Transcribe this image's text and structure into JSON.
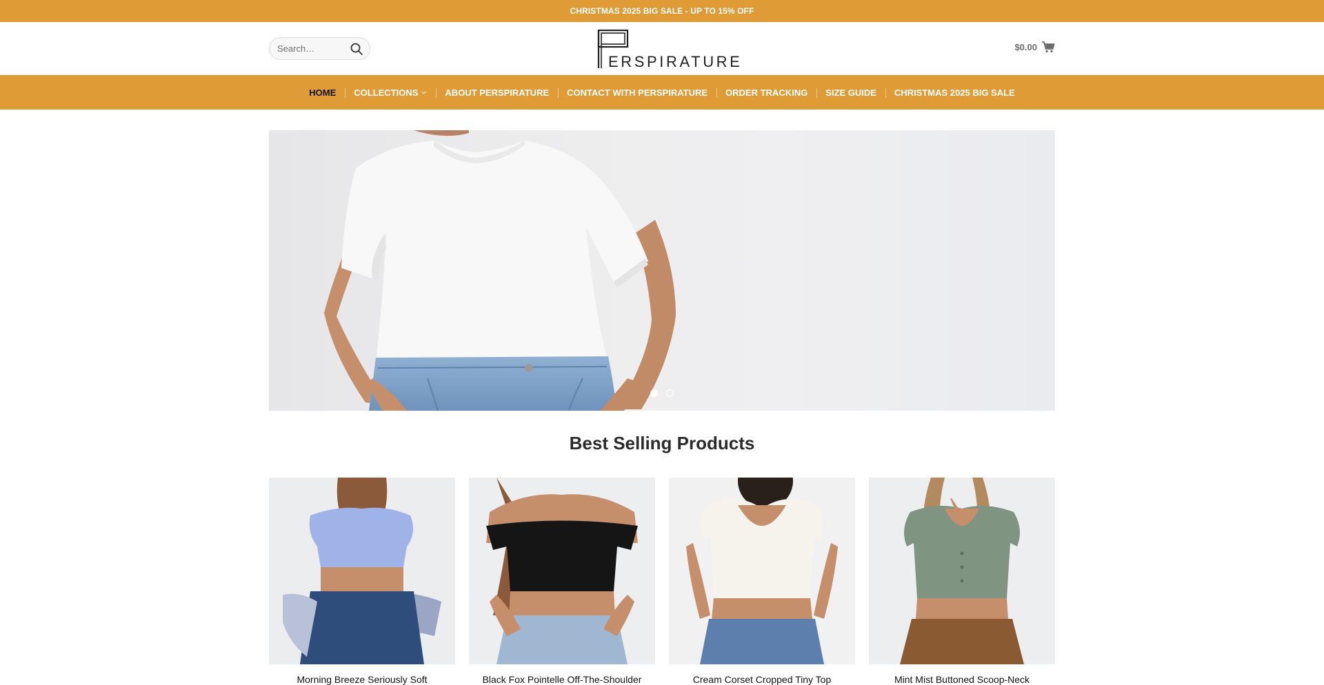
{
  "promo_bar": {
    "text": "CHRISTMAS 2025 BIG SALE - UP TO 15% OFF"
  },
  "header": {
    "search": {
      "placeholder": "Search…"
    },
    "logo": {
      "text": "ERSPIRATURE"
    },
    "cart": {
      "total": "$0.00"
    }
  },
  "nav": {
    "items": [
      {
        "label": "HOME",
        "active": true
      },
      {
        "label": "COLLECTIONS",
        "has_dropdown": true
      },
      {
        "label": "ABOUT PERSPIRATURE"
      },
      {
        "label": "CONTACT WITH PERSPIRATURE"
      },
      {
        "label": "ORDER TRACKING"
      },
      {
        "label": "SIZE GUIDE"
      },
      {
        "label": "CHRISTMAS 2025 BIG SALE"
      }
    ]
  },
  "hero": {
    "slides": 2,
    "active_slide": 1
  },
  "best_selling": {
    "title": "Best Selling Products",
    "products": [
      {
        "name": "Morning Breeze Seriously Soft",
        "top_color": "#9fb3e8",
        "bottom_color": "#2f4d7a"
      },
      {
        "name": "Black Fox Pointelle Off-The-Shoulder",
        "top_color": "#151515",
        "bottom_color": "#9fb7d0"
      },
      {
        "name": "Cream Corset Cropped Tiny Top",
        "top_color": "#f6f3ec",
        "bottom_color": "#5d7fae"
      },
      {
        "name": "Mint Mist Buttoned Scoop-Neck",
        "top_color": "#7f9582",
        "bottom_color": "#8a5a33"
      }
    ]
  },
  "colors": {
    "brand": "#df9c36",
    "skin": "#c58f6c"
  }
}
